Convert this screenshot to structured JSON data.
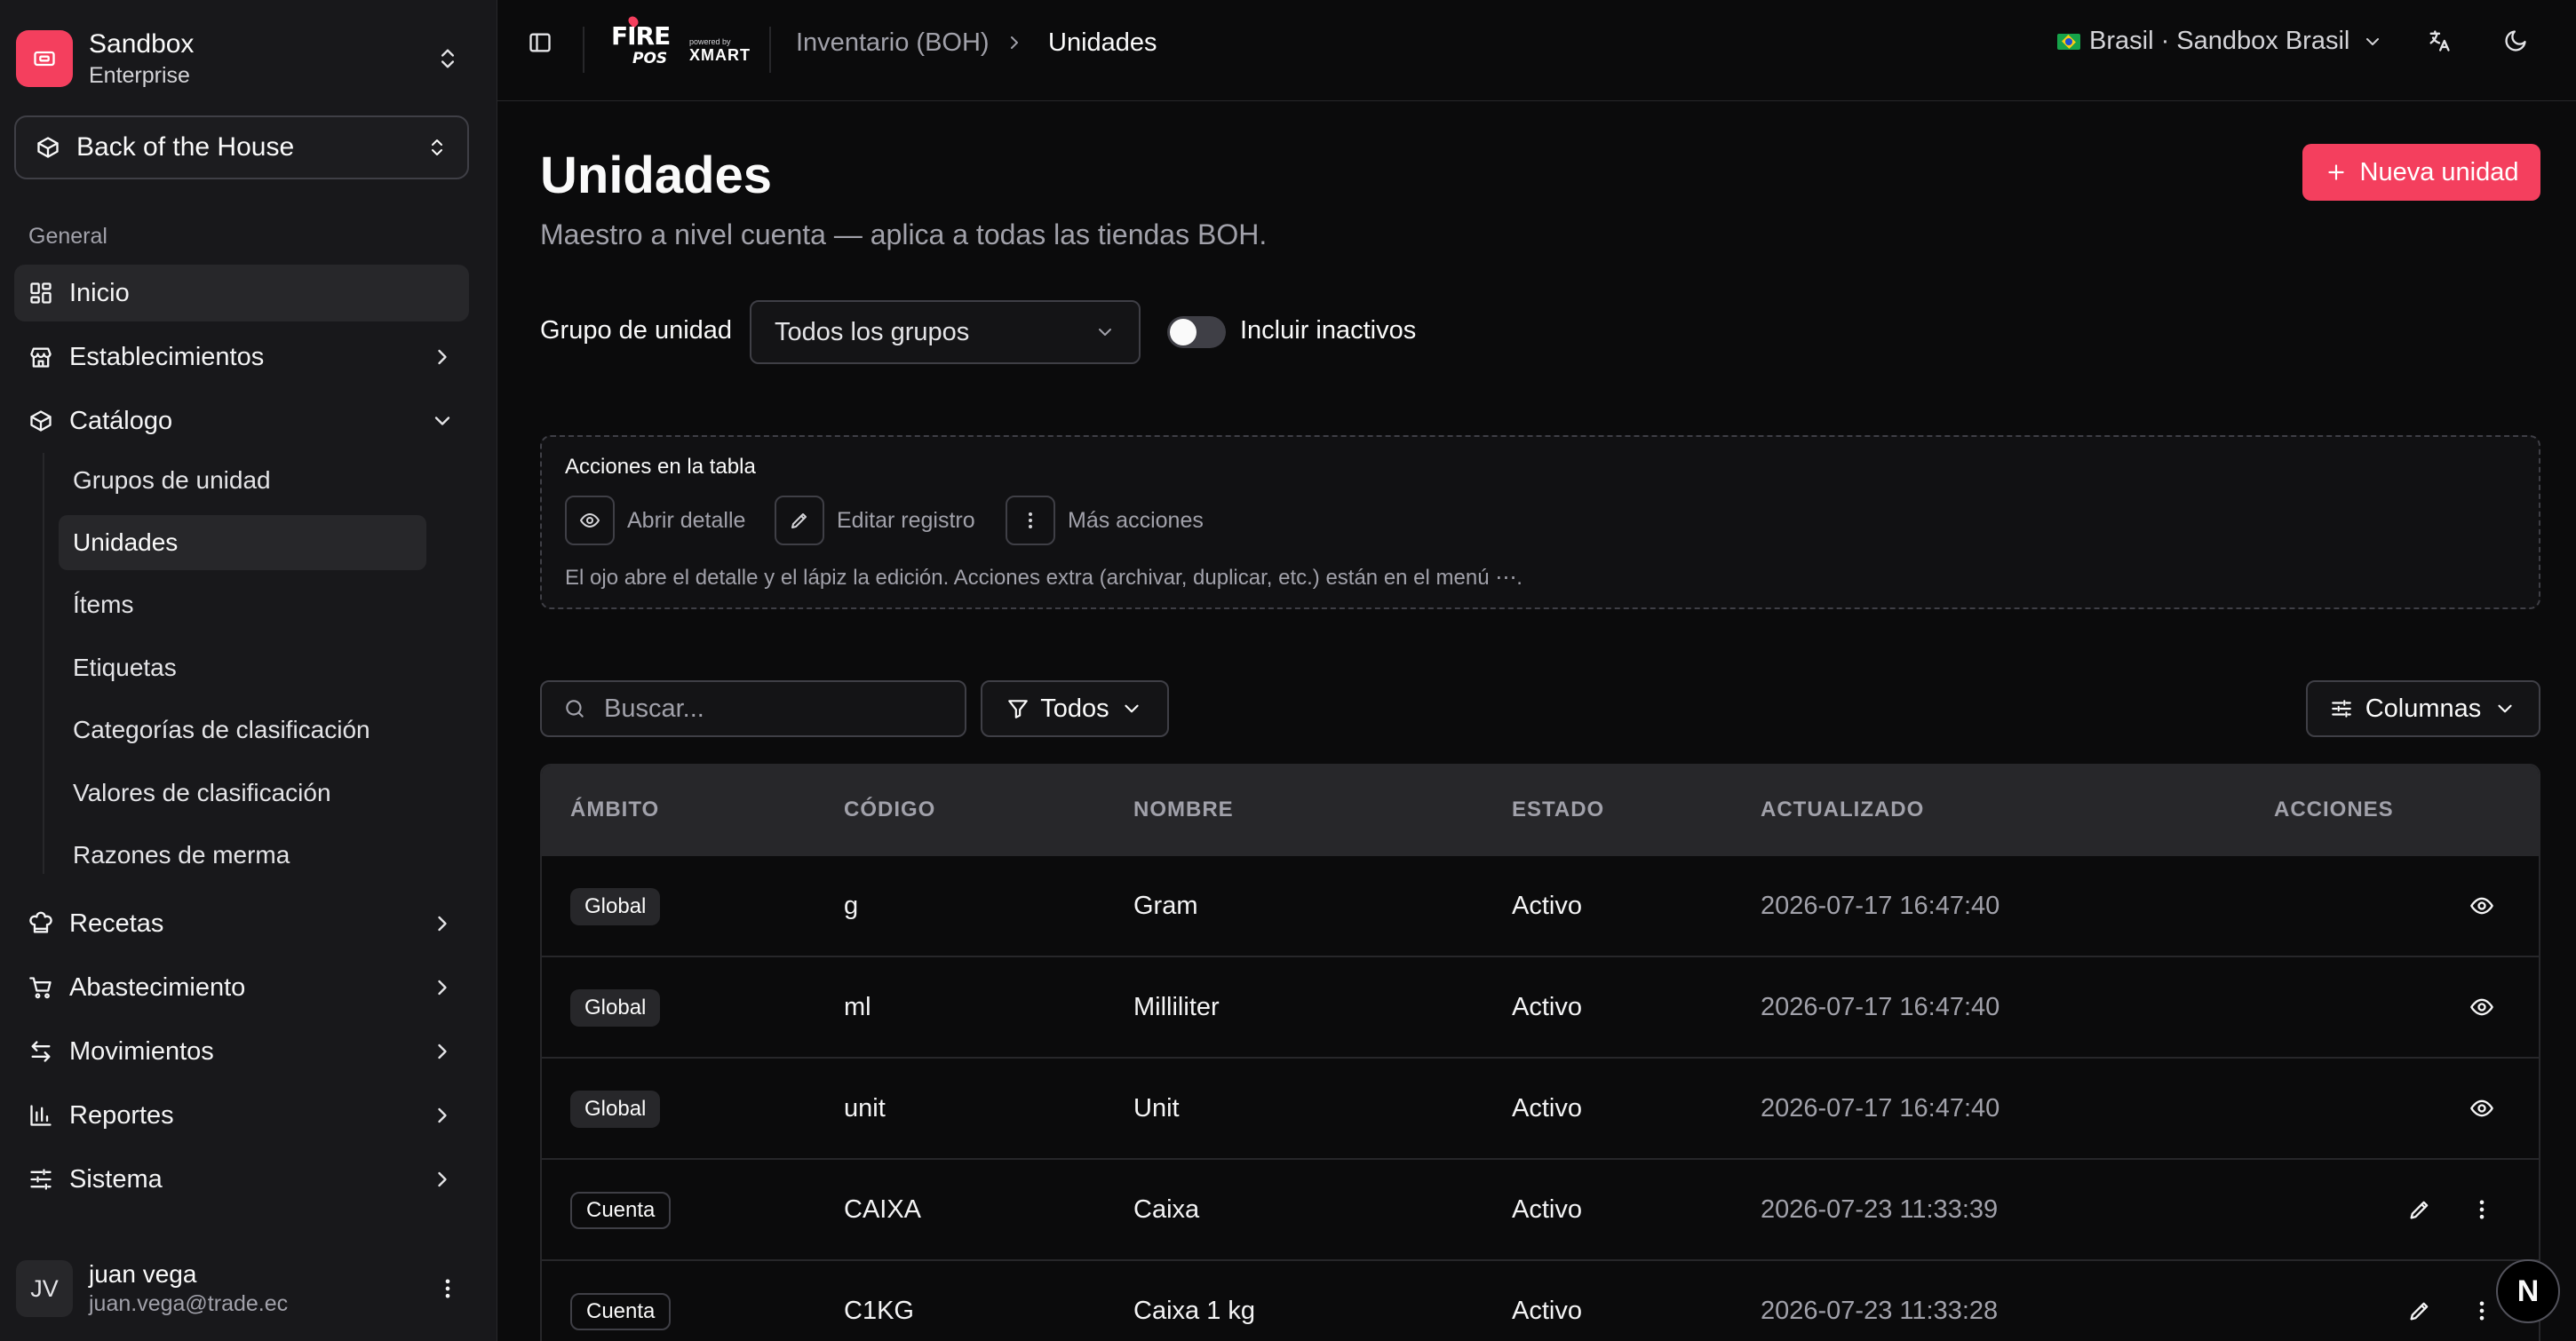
{
  "org": {
    "name": "Sandbox",
    "plan": "Enterprise"
  },
  "module": {
    "label": "Back of the House"
  },
  "nav": {
    "section": "General",
    "inicio": "Inicio",
    "establecimientos": "Establecimientos",
    "catalogo": "Catálogo",
    "catalogo_items": [
      "Grupos de unidad",
      "Unidades",
      "Ítems",
      "Etiquetas",
      "Categorías de clasificación",
      "Valores de clasificación",
      "Razones de merma"
    ],
    "recetas": "Recetas",
    "abastecimiento": "Abastecimiento",
    "movimientos": "Movimientos",
    "reportes": "Reportes",
    "sistema": "Sistema"
  },
  "user": {
    "initials": "JV",
    "name": "juan vega",
    "email": "juan.vega@trade.ec"
  },
  "topbar": {
    "brand_main": "FIRE",
    "brand_sub": "POS",
    "brand_powered": "powered by",
    "brand_partner": "XMART",
    "breadcrumb": [
      "Inventario (BOH)",
      "Unidades"
    ],
    "store": "Brasil · Sandbox Brasil"
  },
  "page": {
    "title": "Unidades",
    "subtitle": "Maestro a nivel cuenta — aplica a todas las tiendas BOH.",
    "new_button": "Nueva unidad"
  },
  "filters": {
    "group_label": "Grupo de unidad",
    "group_value": "Todos los grupos",
    "include_inactive_label": "Incluir inactivos",
    "include_inactive": false
  },
  "help": {
    "title": "Acciones en la tabla",
    "open": "Abrir detalle",
    "edit": "Editar registro",
    "more": "Más acciones",
    "description": "El ojo abre el detalle y el lápiz la edición. Acciones extra (archivar, duplicar, etc.) están en el menú ⋯."
  },
  "toolbar": {
    "search_placeholder": "Buscar...",
    "filter_label": "Todos",
    "columns_label": "Columnas"
  },
  "table": {
    "headers": [
      "ÁMBITO",
      "CÓDIGO",
      "NOMBRE",
      "ESTADO",
      "ACTUALIZADO",
      "ACCIONES"
    ],
    "rows": [
      {
        "scope": "Global",
        "code": "g",
        "name": "Gram",
        "status": "Activo",
        "updated": "2026-07-17 16:47:40"
      },
      {
        "scope": "Global",
        "code": "ml",
        "name": "Milliliter",
        "status": "Activo",
        "updated": "2026-07-17 16:47:40"
      },
      {
        "scope": "Global",
        "code": "unit",
        "name": "Unit",
        "status": "Activo",
        "updated": "2026-07-17 16:47:40"
      },
      {
        "scope": "Cuenta",
        "code": "CAIXA",
        "name": "Caixa",
        "status": "Activo",
        "updated": "2026-07-23 11:33:39"
      },
      {
        "scope": "Cuenta",
        "code": "C1KG",
        "name": "Caixa 1 kg",
        "status": "Activo",
        "updated": "2026-07-23 11:33:28"
      }
    ]
  },
  "fab": {
    "label": "N"
  },
  "colors": {
    "accent": "#f43f5e",
    "background": "#0b0b0c",
    "sidebar": "#18181b",
    "border": "#27272a"
  }
}
